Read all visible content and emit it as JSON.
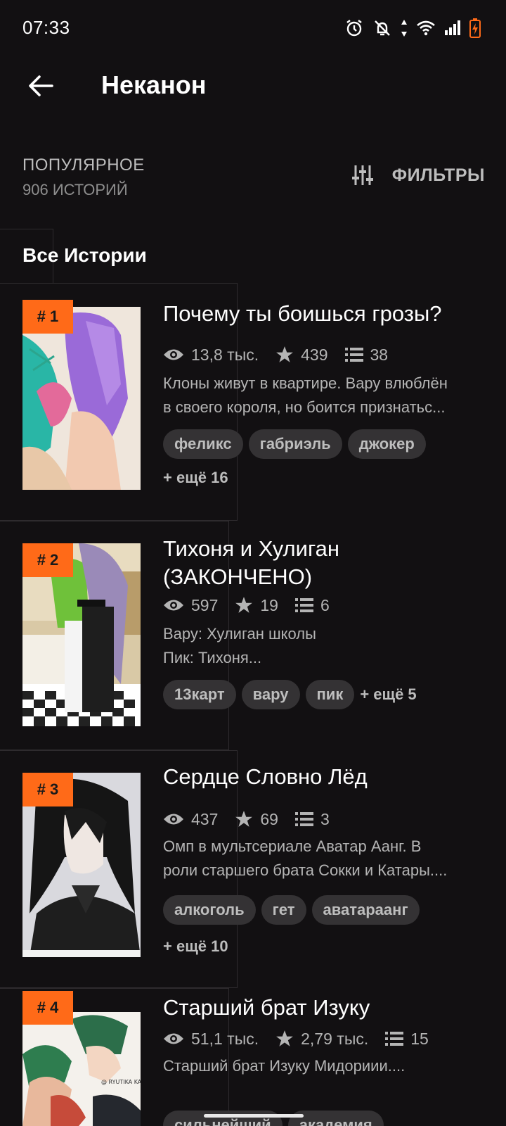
{
  "status_bar": {
    "time": "07:33",
    "icons": [
      "alarm-icon",
      "bell-off-icon",
      "data-arrows-icon",
      "wifi-icon",
      "signal-icon",
      "battery-charging-icon"
    ]
  },
  "app_bar": {
    "title": "Неканон",
    "back_icon": "arrow-left-icon"
  },
  "sort": {
    "label": "ПОПУЛЯРНОЕ",
    "count": "906 ИСТОРИЙ"
  },
  "filter": {
    "label": "ФИЛЬТРЫ",
    "icon": "sliders-icon"
  },
  "section_title": "Все Истории",
  "colors": {
    "accent": "#ff6a18",
    "background": "#121012",
    "tag_bg": "#343234"
  },
  "stories": [
    {
      "rank": "# 1",
      "title": "Почему ты боишься грозы?",
      "views": "13,8 тыс.",
      "stars": "439",
      "chapters": "38",
      "desc_lines": [
        "Клоны живут в квартире. Вару влюблён",
        "в своего короля, но боится признатьс..."
      ],
      "tags": [
        "феликс",
        "габриэль",
        "джокер"
      ],
      "more": "+ ещё 16"
    },
    {
      "rank": "# 2",
      "title_lines": [
        "Тихоня и Хулиган",
        "(ЗАКОНЧЕНО)"
      ],
      "views": "597",
      "stars": "19",
      "chapters": "6",
      "desc_lines": [
        "Вару: Хулиган школы",
        "Пик: Тихоня..."
      ],
      "tags": [
        "13карт",
        "вару",
        "пик"
      ],
      "more": "+ ещё 5"
    },
    {
      "rank": "# 3",
      "title": "Сердце Словно Лёд",
      "views": "437",
      "stars": "69",
      "chapters": "3",
      "desc_lines": [
        "Омп в мультсериале Аватар Аанг. В",
        "роли старшего брата Сокки и Катары...."
      ],
      "tags": [
        "алкоголь",
        "гет",
        "аватарaанг"
      ],
      "more": "+ ещё 10"
    },
    {
      "rank": "# 4",
      "title": "Старший брат Изуку",
      "views": "51,1 тыс.",
      "stars": "2,79 тыс.",
      "chapters": "15",
      "desc_lines": [
        "Старший брат Изуку Мидориии...."
      ],
      "tags": [
        "сильнейший",
        "академия"
      ],
      "cover_caption": "@ RYUTIKA KAMILSOMEN"
    }
  ]
}
